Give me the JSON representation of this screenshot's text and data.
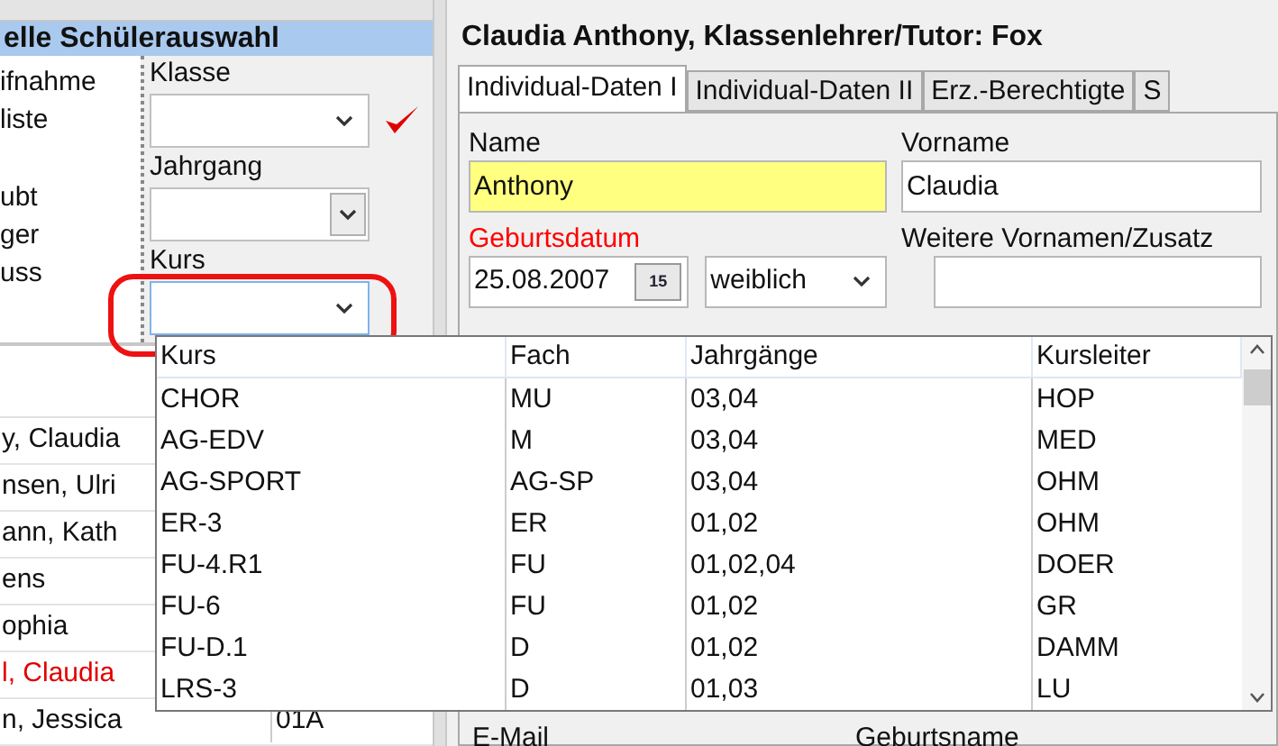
{
  "left_panel": {
    "title": "elle Schülerauswahl",
    "option_groups": [
      [
        "ifnahme",
        "liste"
      ],
      [
        "ubt",
        "ger",
        "uss"
      ]
    ],
    "filters": [
      {
        "label": "Klasse",
        "kind": "plain",
        "checked": true,
        "focused": false,
        "annotated": false
      },
      {
        "label": "Jahrgang",
        "kind": "boxed",
        "checked": false,
        "focused": false,
        "annotated": false
      },
      {
        "label": "Kurs",
        "kind": "plain",
        "checked": false,
        "focused": true,
        "annotated": true
      }
    ],
    "students": [
      {
        "name": "y, Claudia",
        "highlighted": false
      },
      {
        "name": "nsen, Ulri",
        "highlighted": false
      },
      {
        "name": "ann, Kath",
        "highlighted": false
      },
      {
        "name": "ens",
        "highlighted": false
      },
      {
        "name": "ophia",
        "highlighted": false
      },
      {
        "name": "l, Claudia",
        "highlighted": true
      },
      {
        "name": "n, Jessica",
        "class_name": "01A",
        "highlighted": false
      }
    ]
  },
  "right_panel": {
    "title": "Claudia Anthony, Klassenlehrer/Tutor: Fox",
    "tabs": [
      {
        "label": "Individual-Daten I",
        "selected": true
      },
      {
        "label": "Individual-Daten II",
        "selected": false
      },
      {
        "label": "Erz.-Berechtigte",
        "selected": false
      },
      {
        "label": "S",
        "selected": false
      }
    ],
    "name": {
      "label": "Name",
      "value": "Anthony",
      "highlighted": true
    },
    "first_name": {
      "label": "Vorname",
      "value": "Claudia",
      "highlighted": false
    },
    "birth_date": {
      "label": "Geburtsdatum",
      "value": "25.08.2007",
      "required": true,
      "calendar_button": "15"
    },
    "gender": {
      "value": "weiblich"
    },
    "more_names": {
      "label": "Weitere Vornamen/Zusatz"
    },
    "bottom_labels": [
      "E-Mail",
      "Geburtsname"
    ]
  },
  "course_dropdown": {
    "columns": [
      "Kurs",
      "Fach",
      "Jahrgänge",
      "Kursleiter"
    ],
    "rows": [
      [
        "CHOR",
        "MU",
        "03,04",
        "HOP"
      ],
      [
        "AG-EDV",
        "M",
        "03,04",
        "MED"
      ],
      [
        "AG-SPORT",
        "AG-SP",
        "03,04",
        "OHM"
      ],
      [
        "ER-3",
        "ER",
        "01,02",
        "OHM"
      ],
      [
        "FU-4.R1",
        "FU",
        "01,02,04",
        "DOER"
      ],
      [
        "FU-6",
        "FU",
        "01,02",
        "GR"
      ],
      [
        "FU-D.1",
        "D",
        "01,02",
        "DAMM"
      ],
      [
        "LRS-3",
        "D",
        "01,03",
        "LU"
      ]
    ]
  }
}
